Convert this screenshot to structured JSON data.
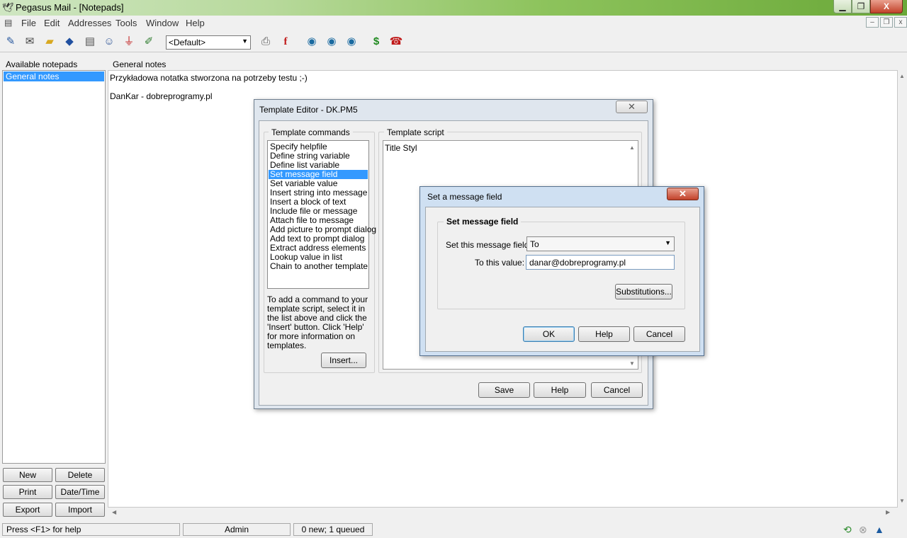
{
  "window": {
    "title": "Pegasus Mail - [Notepads]",
    "min": "▁",
    "max": "❐",
    "close": "X"
  },
  "menu": [
    "File",
    "Edit",
    "Addresses",
    "Tools",
    "Window",
    "Help"
  ],
  "mdi_controls": [
    "–",
    "❐",
    "x"
  ],
  "toolbar": {
    "icons": [
      "new-message",
      "read-mail",
      "open-folder",
      "address-book",
      "notepad",
      "addresses",
      "filter",
      "edit-notepad"
    ],
    "identity": "<Default>",
    "icons2": [
      "print",
      "font",
      "globe-forward",
      "globe-back",
      "globe-check",
      "dollar",
      "phone"
    ]
  },
  "left": {
    "header": "Available notepads",
    "selected": "General notes",
    "buttons": [
      "New",
      "Delete",
      "Print",
      "Date/Time",
      "Export",
      "Import"
    ]
  },
  "content": {
    "header": "General notes",
    "lines": [
      "Przykładowa notatka stworzona na potrzeby testu ;-)",
      "DanKar - dobreprogramy.pl"
    ]
  },
  "status": {
    "help": "Press <F1> for help",
    "user": "Admin",
    "queue": "0 new; 1 queued"
  },
  "template_editor": {
    "title": "Template Editor - DK.PM5",
    "commands_label": "Template commands",
    "script_label": "Template script",
    "commands": [
      "Specify helpfile",
      "Define string variable",
      "Define list variable",
      "Set message field",
      "Set variable value",
      "Insert string into message",
      "Insert a block of text",
      "Include file or message",
      "Attach file to message",
      "Add picture to prompt dialog",
      "Add text to prompt dialog",
      "Extract address elements",
      "Lookup value in list",
      "Chain to another template"
    ],
    "selected_index": 3,
    "help_text": "To add a command to your template script, select it in the list above and click the 'Insert' button. Click 'Help' for more information on templates.",
    "insert": "Insert...",
    "script": "Title Styl",
    "save": "Save",
    "help": "Help",
    "cancel": "Cancel"
  },
  "set_field": {
    "title": "Set a message field",
    "group": "Set message field",
    "field_label": "Set this message field:",
    "field_value": "To",
    "value_label": "To this value:",
    "value": "danar@dobreprogramy.pl",
    "subs": "Substitutions...",
    "ok": "OK",
    "help": "Help",
    "cancel": "Cancel"
  }
}
